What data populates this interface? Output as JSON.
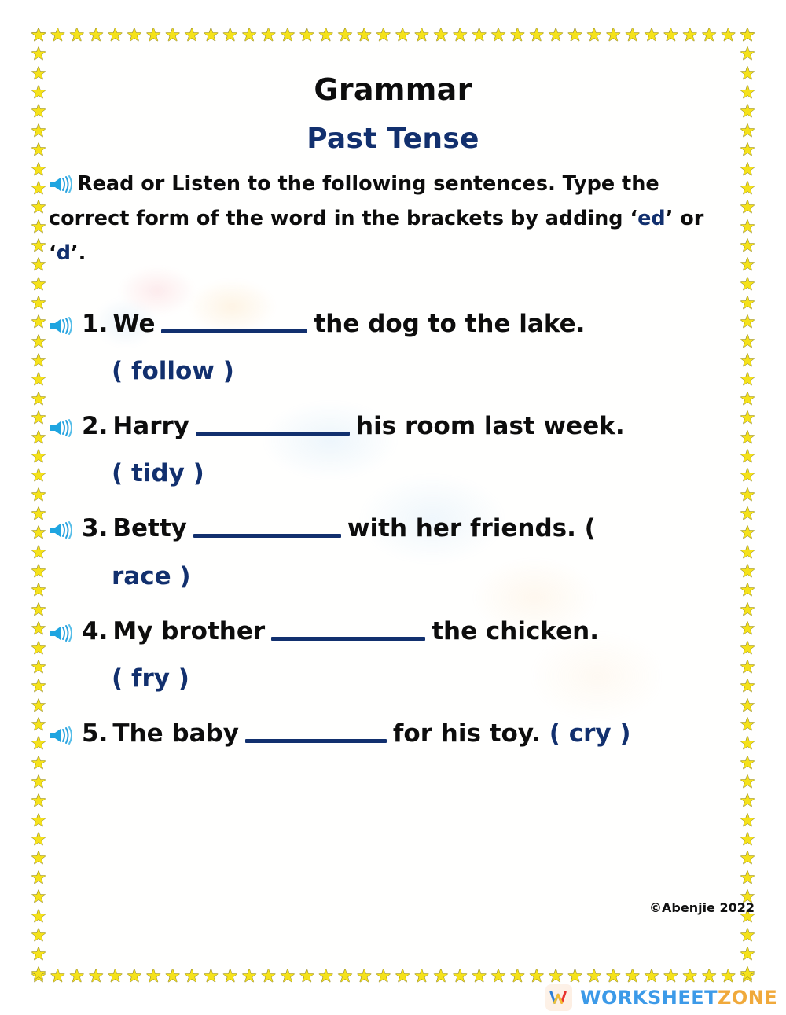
{
  "worksheet": {
    "title": "Grammar",
    "subtitle": "Past Tense",
    "instructions": {
      "part1": "Read or Listen to the following sentences. Type the correct form of the word in the brackets by adding ‘",
      "highlight1": "ed",
      "part2": "’ or ‘",
      "highlight2": "d",
      "part3": "’."
    },
    "questions": [
      {
        "number": "1.",
        "before": "We",
        "after": "the dog to the lake.",
        "word": "( follow )",
        "blank_style": "b1"
      },
      {
        "number": "2.",
        "before": "Harry",
        "after": "his room last week.",
        "word": "( tidy )",
        "blank_style": "b2"
      },
      {
        "number": "3.",
        "before": "Betty",
        "after": "with her friends. (",
        "word": "race )",
        "blank_style": "b3"
      },
      {
        "number": "4.",
        "before": "My brother",
        "after": "the chicken.",
        "word": "( fry )",
        "blank_style": "b4"
      },
      {
        "number": "5.",
        "before": "The baby",
        "after": "for his toy.",
        "word": "( cry )",
        "blank_style": "b5"
      }
    ],
    "copyright": "©Abenjie 2022"
  },
  "brand": {
    "name_part1": "WORKSHEET",
    "name_part2": "ZONE",
    "mark_letter": "W"
  },
  "colors": {
    "navy": "#12306e",
    "black": "#0d0d0d",
    "star_yellow": "#f5e21a",
    "brand_blue": "#3c9ae8",
    "brand_orange": "#f0a93b",
    "speaker_blue": "#29a3e0"
  }
}
